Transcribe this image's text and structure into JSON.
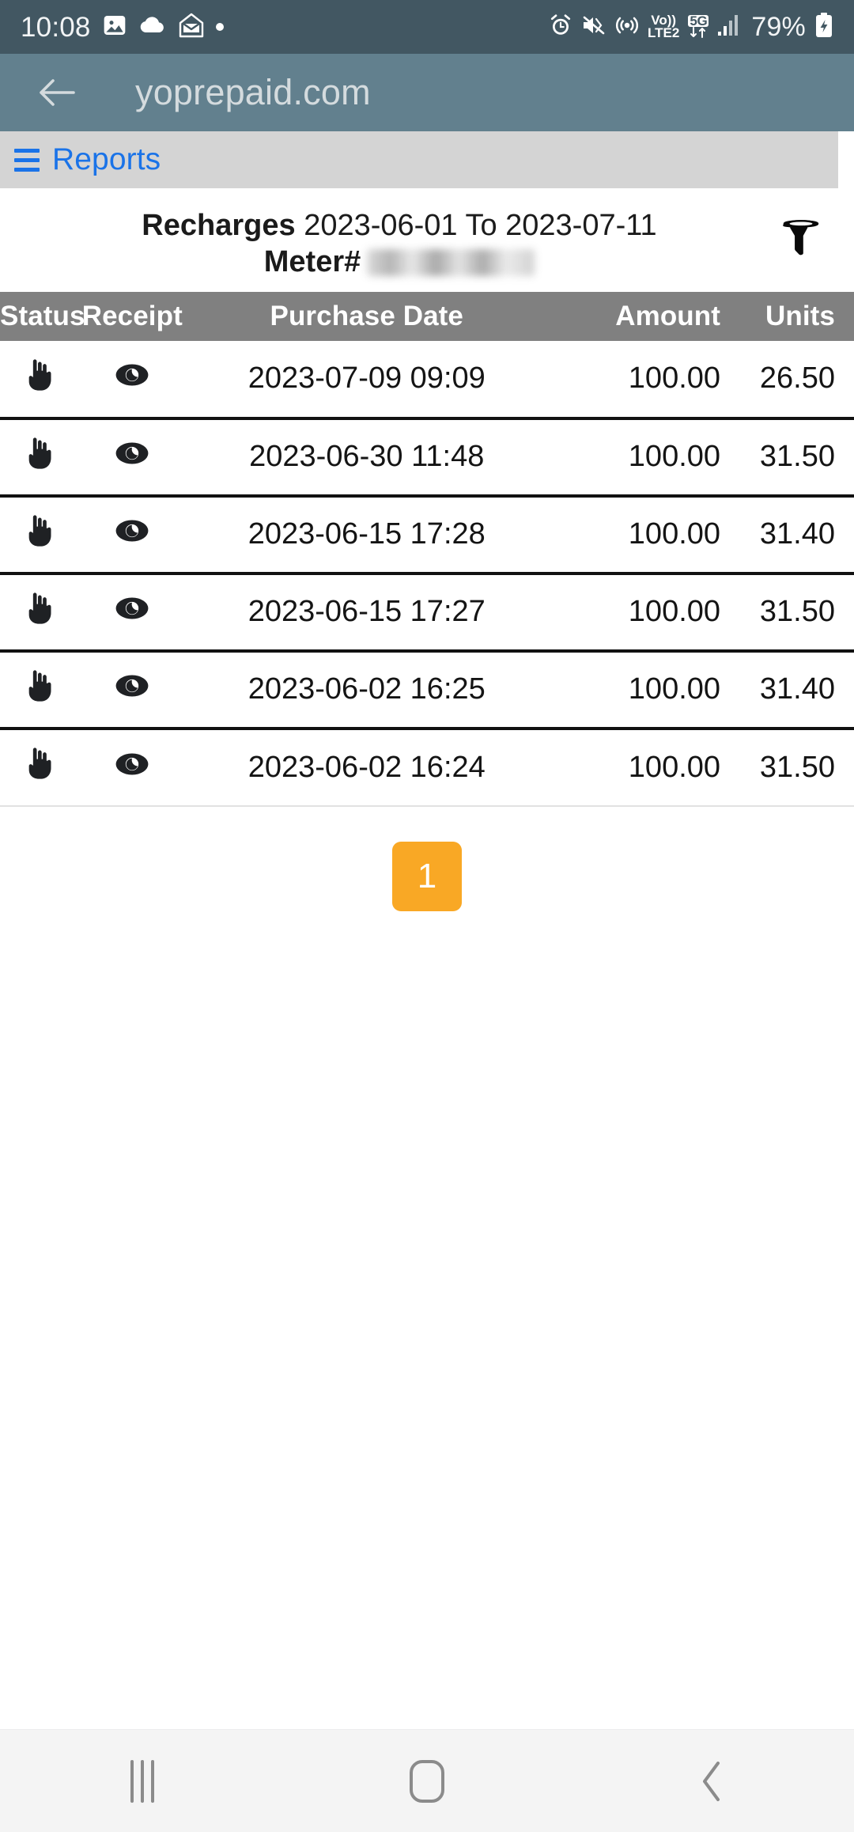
{
  "status_bar": {
    "time": "10:08",
    "battery_percent": "79%",
    "volte_top": "Vo))",
    "volte_bottom": "LTE2",
    "network": "5G",
    "left_icons": [
      "image-icon",
      "cloud-icon",
      "mail-icon",
      "dot-indicator-icon"
    ],
    "right_icons": [
      "alarm-icon",
      "mute-vibrate-icon",
      "hotspot-icon",
      "volte-icon",
      "five-g-data-icon",
      "signal-bars-icon",
      "battery-charging-icon"
    ],
    "bg_color": "#425762"
  },
  "app_bar": {
    "title": "yoprepaid.com",
    "back_icon": "back-arrow-icon",
    "bg_color": "#62808e",
    "title_color": "#d4dbde"
  },
  "nav_strip": {
    "menu_icon": "hamburger-menu-icon",
    "label": "Reports",
    "link_color": "#1a73e8",
    "bg_color": "#d4d4d4"
  },
  "report": {
    "title": "Recharges",
    "date_range": "2023-06-01 To 2023-07-11",
    "meter_label": "Meter#",
    "meter_value": "",
    "filter_icon": "filter-funnel-icon"
  },
  "table": {
    "header_bg": "#808080",
    "columns": [
      "Status",
      "Receipt",
      "Purchase Date",
      "Amount",
      "Units"
    ],
    "rows": [
      {
        "status_icon": "pointing-hand-icon",
        "receipt_icon": "eye-icon",
        "date": "2023-07-09 09:09",
        "amount": "100.00",
        "units": "26.50"
      },
      {
        "status_icon": "pointing-hand-icon",
        "receipt_icon": "eye-icon",
        "date": "2023-06-30 11:48",
        "amount": "100.00",
        "units": "31.50"
      },
      {
        "status_icon": "pointing-hand-icon",
        "receipt_icon": "eye-icon",
        "date": "2023-06-15 17:28",
        "amount": "100.00",
        "units": "31.40"
      },
      {
        "status_icon": "pointing-hand-icon",
        "receipt_icon": "eye-icon",
        "date": "2023-06-15 17:27",
        "amount": "100.00",
        "units": "31.50"
      },
      {
        "status_icon": "pointing-hand-icon",
        "receipt_icon": "eye-icon",
        "date": "2023-06-02 16:25",
        "amount": "100.00",
        "units": "31.40"
      },
      {
        "status_icon": "pointing-hand-icon",
        "receipt_icon": "eye-icon",
        "date": "2023-06-02 16:24",
        "amount": "100.00",
        "units": "31.50"
      }
    ]
  },
  "pagination": {
    "current_page": "1",
    "accent_color": "#F9A825"
  },
  "system_nav": {
    "recents_icon": "recents-icon",
    "home_icon": "home-icon",
    "back_icon": "back-chevron-icon",
    "bg_color": "#f4f4f4"
  }
}
